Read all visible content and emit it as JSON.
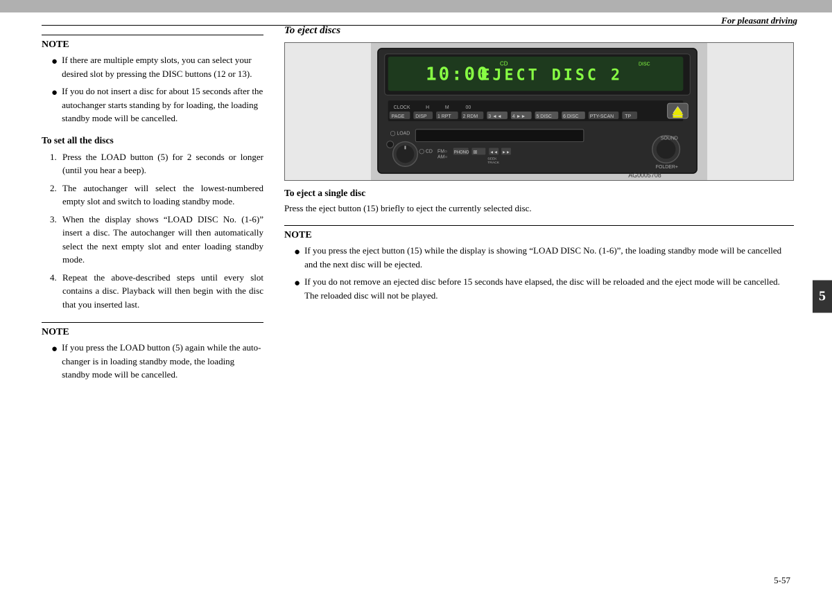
{
  "header": {
    "right_text": "For pleasant driving"
  },
  "left_column": {
    "note1_label": "NOTE",
    "note1_items": [
      "If there are multiple empty slots, you can select your desired slot by pressing the DISC buttons (12 or 13).",
      "If you do not insert a disc for about 15 seconds after the autochanger starts standing by for loading, the loading standby mode will be cancelled."
    ],
    "section_heading": "To set all the discs",
    "steps": [
      "Press the LOAD button (5) for 2 seconds or longer (until you hear a beep).",
      "The autochanger will select the lowest-numbered empty slot and switch to loading standby mode.",
      "When the display shows “LOAD DISC No. (1-6)” insert a disc. The autochanger will then automatically select the next empty slot and enter loading standby mode.",
      "Repeat the above-described steps until every slot contains a disc. Playback will then begin with the disc that you inserted last."
    ],
    "note2_label": "NOTE",
    "note2_items": [
      "If you press the LOAD button (5) again while the autochanger is in loading standby mode, the loading standby mode will be cancelled."
    ]
  },
  "right_column": {
    "eject_heading": "To eject discs",
    "display_text": "EJECT DISC 2",
    "display_time": "10:00",
    "image_code": "AG0005708",
    "single_disc_heading": "To eject a single disc",
    "single_disc_text": "Press the eject button (15) briefly to eject the currently selected disc.",
    "note3_label": "NOTE",
    "note3_items": [
      "If you press the eject button (15) while the display is showing “LOAD DISC No. (1-6)”, the loading standby mode will be cancelled and the next disc will be ejected.",
      "If you do not remove an ejected disc before 15 seconds have elapsed, the disc will be reloaded and the eject mode will be cancelled. The reloaded disc will not be played."
    ]
  },
  "footer": {
    "page_number": "5-57"
  },
  "side_tab": "5"
}
